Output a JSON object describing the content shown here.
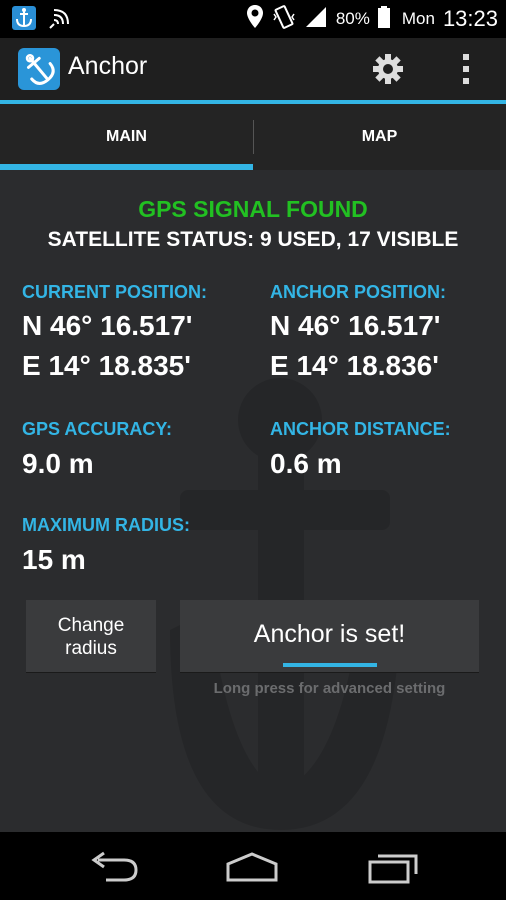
{
  "status_bar": {
    "battery": "80%",
    "day": "Mon",
    "time": "13:23"
  },
  "app": {
    "title": "Anchor"
  },
  "tabs": [
    {
      "label": "MAIN",
      "selected": true
    },
    {
      "label": "MAP",
      "selected": false
    }
  ],
  "gps": {
    "signal": "GPS SIGNAL FOUND",
    "satellite_status": "SATELLITE STATUS: 9 USED, 17 VISIBLE"
  },
  "current_position": {
    "label": "CURRENT POSITION:",
    "lat": "N 46° 16.517'",
    "lon": "E 14° 18.835'"
  },
  "anchor_position": {
    "label": "ANCHOR POSITION:",
    "lat": "N 46° 16.517'",
    "lon": "E 14° 18.836'"
  },
  "gps_accuracy": {
    "label": "GPS ACCURACY:",
    "value": "9.0 m"
  },
  "anchor_distance": {
    "label": "ANCHOR DISTANCE:",
    "value": "0.6 m"
  },
  "max_radius": {
    "label": "MAXIMUM RADIUS:",
    "value": "15 m"
  },
  "buttons": {
    "change_radius_line1": "Change",
    "change_radius_line2": "radius",
    "anchor_set": "Anchor is set!",
    "hint": "Long press for advanced setting"
  },
  "colors": {
    "accent": "#33b5e5",
    "signal_ok": "#22c022"
  },
  "icons": {
    "app": "anchor-icon",
    "settings": "gear-icon",
    "overflow": "overflow-menu-icon",
    "back": "back-icon",
    "home": "home-icon",
    "recent": "recent-apps-icon"
  }
}
